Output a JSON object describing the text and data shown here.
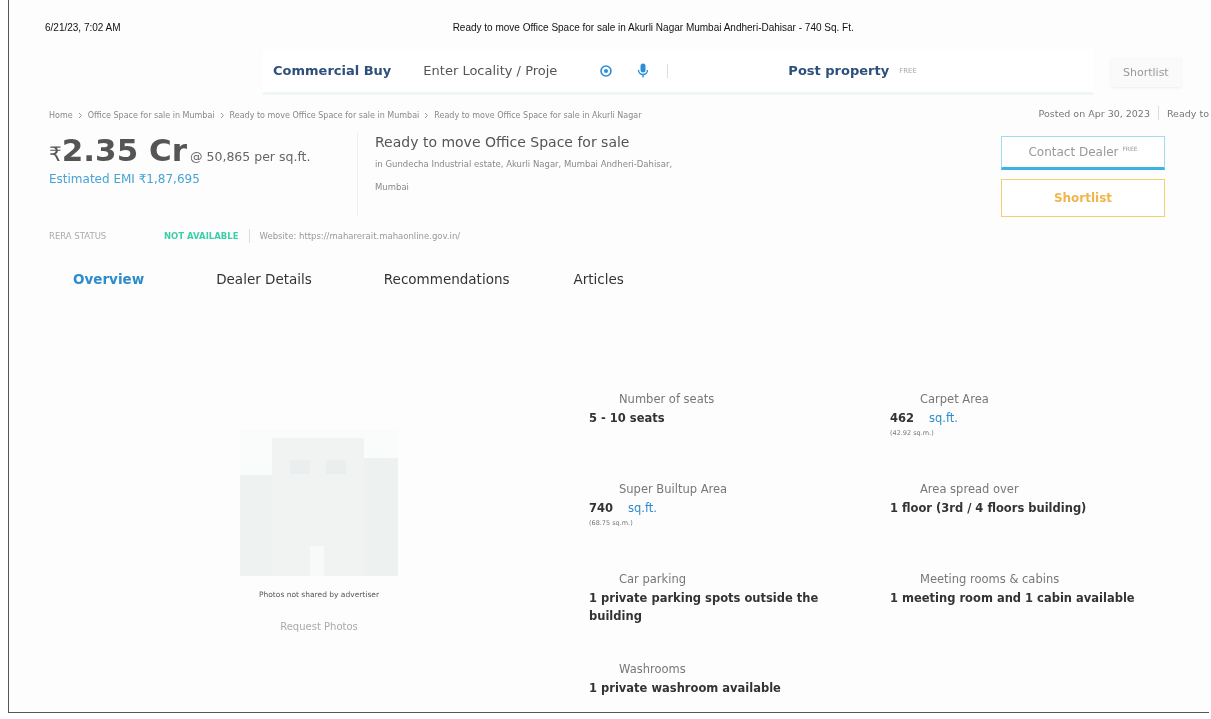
{
  "print_header": {
    "date": "6/21/23, 7:02 AM",
    "title": "Ready to move Office Space for sale in Akurli Nagar Mumbai Andheri-Dahisar - 740 Sq. Ft."
  },
  "nav": {
    "category": "Commercial Buy",
    "search": {
      "placeholder": "Enter Locality / Proje"
    },
    "post_property": "Post property",
    "post_badge": "FREE",
    "shortlist": "Shortlist"
  },
  "breadcrumbs": [
    "Home",
    "Office Space for sale in Mumbai",
    "Ready to move Office Space for sale in Mumbai",
    "Ready to move Office Space for sale in Akurli Nagar"
  ],
  "posted": "Posted on Apr 30, 2023",
  "status": "Ready to",
  "price": {
    "currency": "₹",
    "amount": "2.35 Cr",
    "rate": "@ 50,865 per sq.ft.",
    "emi": "Estimated EMI ₹1,87,695"
  },
  "listing": {
    "title": "Ready to move Office Space for sale",
    "address": "in Gundecha Industrial estate, Akurli Nagar, Mumbai Andheri-Dahisar,",
    "city": "Mumbai"
  },
  "actions": {
    "contact": "Contact Dealer",
    "contact_badge": "FREE",
    "shortlist": "Shortlist"
  },
  "rera": {
    "label": "RERA STATUS",
    "value": "NOT AVAILABLE",
    "website": "Website: https://maharerait.mahaonline.gov.in/"
  },
  "tabs": [
    {
      "label": "Overview",
      "selected": true
    },
    {
      "label": "Dealer Details",
      "selected": false
    },
    {
      "label": "Recommendations",
      "selected": false
    },
    {
      "label": "Articles",
      "selected": false
    }
  ],
  "photo": {
    "kind": "picture",
    "caption": "Photos not shared by advertiser",
    "request": "Request Photos"
  },
  "details": [
    {
      "label": "Number of seats",
      "value": "5 - 10 seats"
    },
    {
      "label": "Carpet Area",
      "value": "462",
      "unit": "sq.ft.",
      "sub": "(42.92 sq.m.)"
    },
    {
      "label": "Super Builtup Area",
      "value": "740",
      "unit": "sq.ft.",
      "sub": "(68.75 sq.m.)"
    },
    {
      "label": "Area spread over",
      "value": "1 floor (3rd / 4 floors building)"
    },
    {
      "label": "Car parking",
      "value": "1 private parking spots outside the building"
    },
    {
      "label": "Meeting rooms & cabins",
      "value": "1 meeting room and 1 cabin available"
    },
    {
      "label": "Washrooms",
      "value": "1 private washroom available"
    }
  ]
}
